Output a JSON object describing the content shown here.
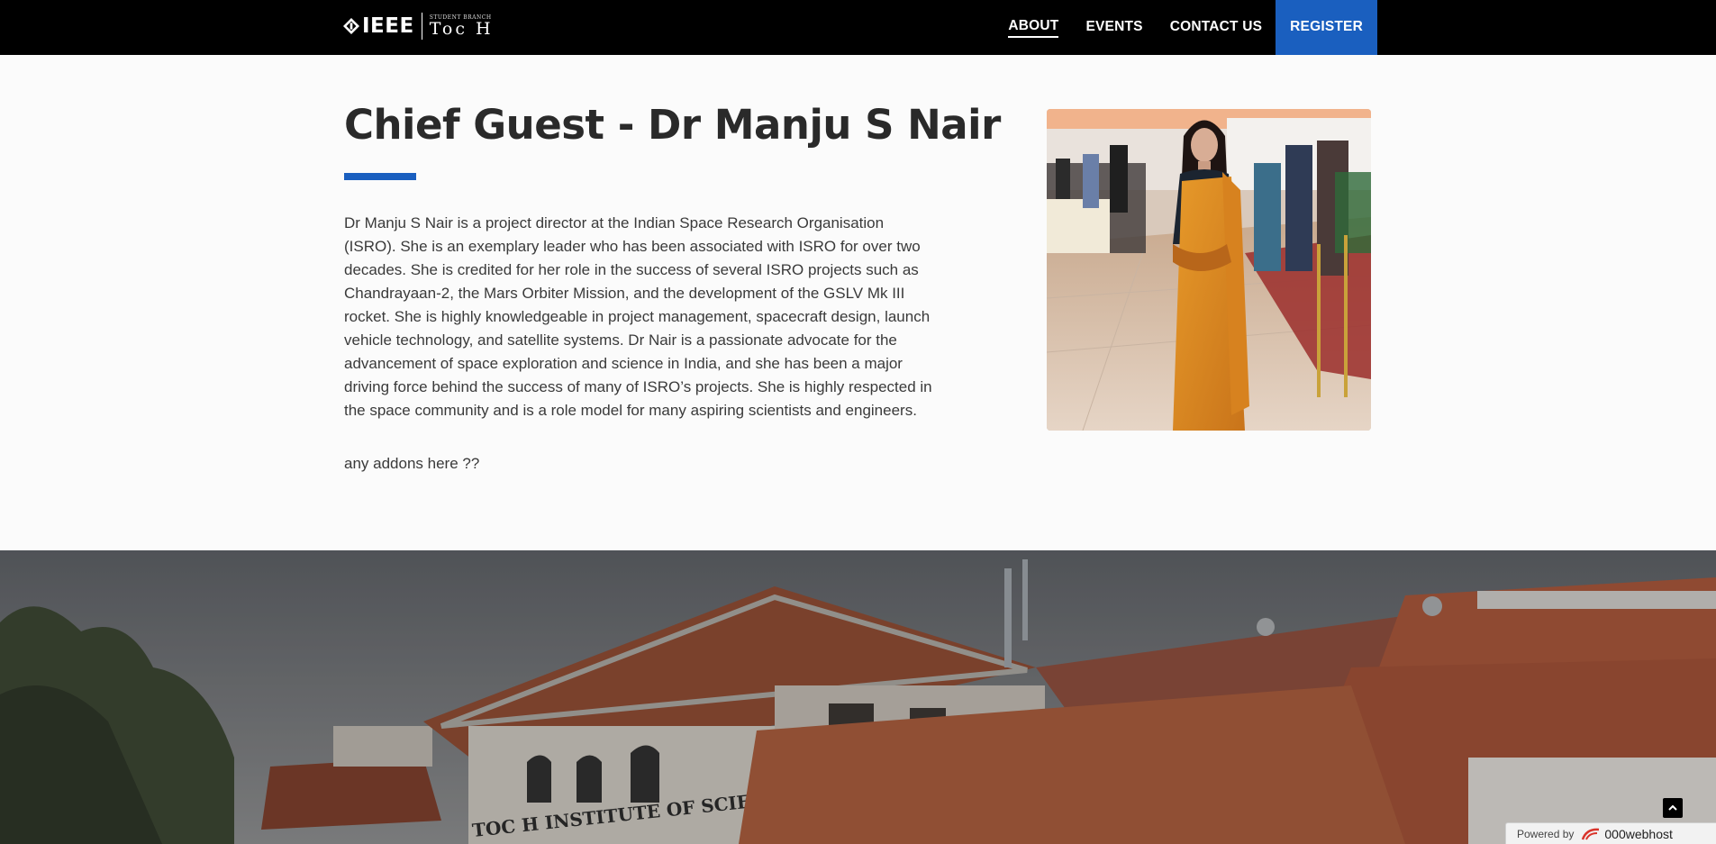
{
  "navbar": {
    "logo": {
      "brand": "IEEE",
      "branch_tiny": "STUDENT BRANCH",
      "branch_name": "Toc H"
    },
    "items": [
      {
        "label": "ABOUT",
        "active": true
      },
      {
        "label": "EVENTS",
        "active": false
      },
      {
        "label": "CONTACT US",
        "active": false
      },
      {
        "label": "REGISTER",
        "active": false
      }
    ]
  },
  "main": {
    "title": "Chief Guest - Dr Manju S Nair",
    "bio": "Dr Manju S Nair is a project director at the Indian Space Research Organisation (ISRO). She is an exemplary leader who has been associated with ISRO for over two decades. She is credited for her role in the success of several ISRO projects such as Chandrayaan-2, the Mars Orbiter Mission, and the development of the GSLV Mk III rocket. She is highly knowledgeable in project management, spacecraft design, launch vehicle technology, and satellite systems. Dr Nair is a passionate advocate for the advancement of space exploration and science in India, and she has been a major driving force behind the success of many of ISRO’s projects. She is highly respected in the space community and is a role model for many aspiring scientists and engineers.",
    "addons": "any addons here ??"
  },
  "banner": {
    "sign_text": "TOC H INSTITUTE OF SCIENCE & TECHNOLOGY"
  },
  "widget": {
    "powered_by": "Powered by",
    "host": "000webhost"
  },
  "colors": {
    "accent": "#1a5fbf",
    "navbar_bg": "#000000",
    "page_bg": "#fbfbfb"
  }
}
